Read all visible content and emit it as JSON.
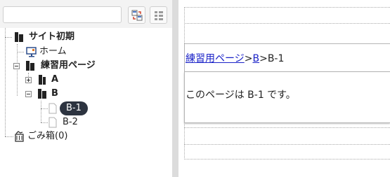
{
  "search": {
    "value": "",
    "placeholder": ""
  },
  "toolbar": {
    "sync_icon": "sync-tree-icon",
    "grid_icon": "grid-view-icon"
  },
  "tree": {
    "site_root": "サイト初期",
    "home": "ホーム",
    "practice_page": "練習用ページ",
    "a": "A",
    "b": "B",
    "b1": "B-1",
    "b2": "B-2",
    "trash": "ごみ箱(0)"
  },
  "content": {
    "crumb_1": "練習用ページ",
    "sep_1": ">",
    "crumb_2": "B",
    "sep_2": ">",
    "crumb_current": "B-1",
    "body_text": "このページは B-1 です。"
  },
  "colors": {
    "selected_bg": "#2d3440",
    "link": "#1a22c8",
    "splitter": "#dcdcdc"
  }
}
